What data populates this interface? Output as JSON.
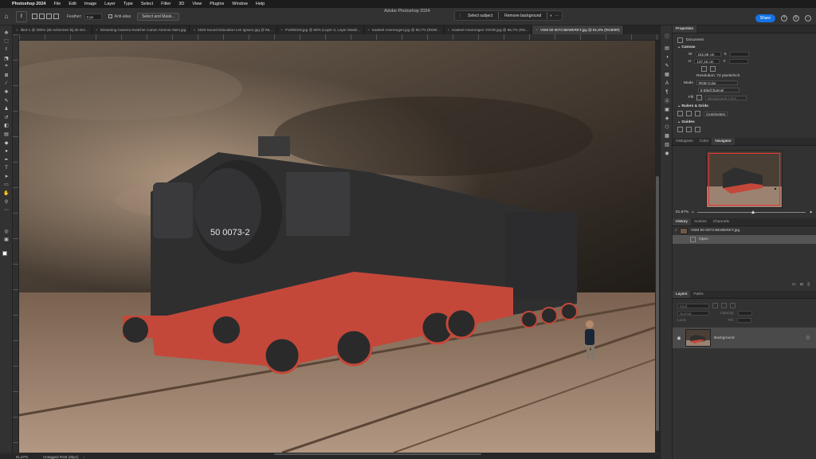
{
  "menubar": {
    "app": "Photoshop 2024",
    "items": [
      "File",
      "Edit",
      "Image",
      "Layer",
      "Type",
      "Select",
      "Filter",
      "3D",
      "View",
      "Plugins",
      "Window",
      "Help"
    ]
  },
  "appbar": {
    "title": "Adobe Photoshop 2024",
    "feather_label": "Feather:",
    "feather_value": "0 px",
    "antialias_label": "Anti-alias",
    "select_mask_label": "Select and Mask...",
    "select_subject_label": "Select subject",
    "remove_bg_label": "Remove background",
    "share_label": "Share"
  },
  "tabs": [
    {
      "label": "itled-1 @ 300% (de schermen bij de NO...",
      "active": false
    },
    {
      "label": "Streaming Camera Switcher Canon Atomos Atem.jpg",
      "active": false
    },
    {
      "label": "2020 Sound Education Les Ignace.jpg @ 66,...",
      "active": false
    },
    {
      "label": "P1090316.jpg @ 50% (Layer 3, Layer Mask/...",
      "active": false
    },
    {
      "label": "Kasteel Amerongen.jpg @ 66,7% (RGB/...",
      "active": false
    },
    {
      "label": "Kasteel Amerongen VOOR.jpg @ 66,7% (RG...",
      "active": false
    },
    {
      "label": "VSM 50 0073 BEWERKT.jpg @ 81,9% (RGB/8#)",
      "active": true
    }
  ],
  "canvas": {
    "loco_number": "50 0073-2"
  },
  "statusbar": {
    "zoom": "81,87%",
    "profile": "Untagged RGB (8bpc)"
  },
  "properties": {
    "tab_label": "Properties",
    "doc_label": "Document",
    "canvas_heading": "Canvas",
    "w_label": "W",
    "w_value": "162,88 cm",
    "h_label": "H",
    "h_value": "137,16 cm",
    "x_label": "X",
    "y_label": "Y",
    "resolution": "Resolution: 72 pixels/inch",
    "mode_label": "Mode",
    "mode_value": "RGB Color",
    "depth_value": "8 Bits/Channel",
    "fill_label": "Fill",
    "fill_value": "Background Color",
    "rulers_heading": "Rulers & Grids",
    "units_value": "Centimeters",
    "guides_heading": "Guides"
  },
  "navigator": {
    "tabs": [
      "Histogram",
      "Color",
      "Navigator"
    ],
    "active_tab": "Navigator",
    "zoom": "81,87%"
  },
  "history": {
    "tabs": [
      "History",
      "Actions",
      "Channels"
    ],
    "items": [
      {
        "label": "VSM 50 0073 BEWERKT.jpg",
        "snapshot": true
      },
      {
        "label": "Open",
        "snapshot": false
      }
    ]
  },
  "layers": {
    "tabs": [
      "Layers",
      "Paths"
    ],
    "kind_placeholder": "Kind",
    "blend_mode": "Normal",
    "opacity_label": "Opacity:",
    "lock_label": "Lock:",
    "fill_label": "Fill:",
    "layer_name": "Background"
  },
  "colors": {
    "accent": "#1473e6",
    "sky_dark": "#2e2620",
    "sky_light": "#7d6c5b",
    "ground": "#8f7460",
    "loco_body": "#2f2f30",
    "loco_red": "#c4483a"
  }
}
